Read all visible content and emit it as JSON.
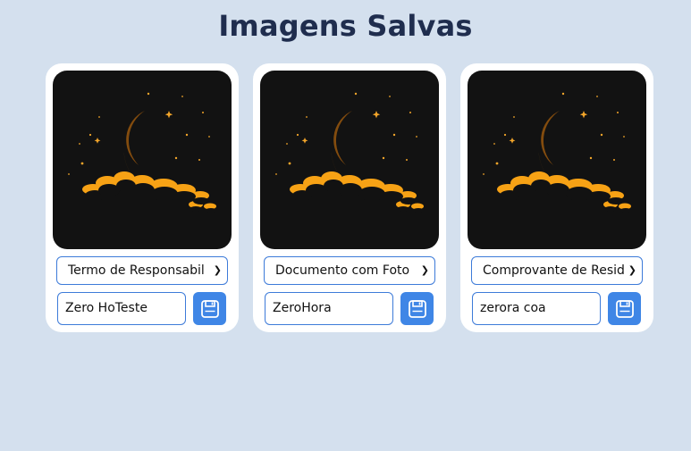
{
  "page": {
    "title": "Imagens Salvas"
  },
  "colors": {
    "background": "#d4e0ee",
    "card": "#ffffff",
    "accent": "#3f86e6",
    "title": "#1f2d4e",
    "moon": "#f29b0c"
  },
  "cards": [
    {
      "image_icon": "crescent-moon-night-sky",
      "document_type": "Termo de Responsabil",
      "name_value": "Zero HoTeste",
      "save_icon": "floppy-disk-icon"
    },
    {
      "image_icon": "crescent-moon-night-sky",
      "document_type": "Documento com Foto",
      "name_value": "ZeroHora",
      "save_icon": "floppy-disk-icon"
    },
    {
      "image_icon": "crescent-moon-night-sky",
      "document_type": "Comprovante de Resid",
      "name_value": "zerora coa",
      "save_icon": "floppy-disk-icon"
    }
  ]
}
